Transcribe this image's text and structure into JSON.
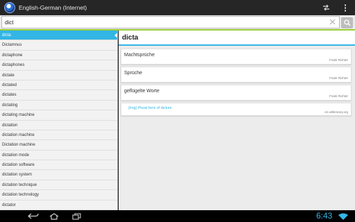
{
  "action_bar": {
    "title": "English-German (Internet)",
    "icons": {
      "app": "dictionary-globe-icon",
      "sync": "swap-arrows-icon",
      "menu": "overflow-menu-icon"
    }
  },
  "search": {
    "value": "dict",
    "icons": {
      "clear": "clear-icon",
      "search": "search-icon"
    }
  },
  "sidebar": {
    "items": [
      "dicta",
      "Dictamnus",
      "dictaphone",
      "dictaphones",
      "dictate",
      "dictated",
      "dictates",
      "dictating",
      "dictating machine",
      "dictation",
      "dictation machine",
      "Dictation machine",
      "dictation mode",
      "dictation software",
      "dictation system",
      "dictation technique",
      "dictation technology",
      "dictator"
    ],
    "active_index": 0
  },
  "entry": {
    "headword": "dicta",
    "translations": [
      {
        "text": "Machtsprüche",
        "author": "Frank Richter"
      },
      {
        "text": "Sprüche",
        "author": "Frank Richter"
      },
      {
        "text": "geflügelte Worte",
        "author": "Frank Richter"
      }
    ],
    "definition": {
      "text": "{Img} Plural form of dictum.",
      "source": "en.wiktionary.org"
    }
  },
  "system_bar": {
    "time": "6:43",
    "icons": {
      "back": "back-icon",
      "home": "home-icon",
      "recents": "recent-apps-icon",
      "wifi": "wifi-icon"
    }
  },
  "colors": {
    "accent": "#33b5e5",
    "search_border": "#9acd32",
    "action_bar": "#262626"
  }
}
